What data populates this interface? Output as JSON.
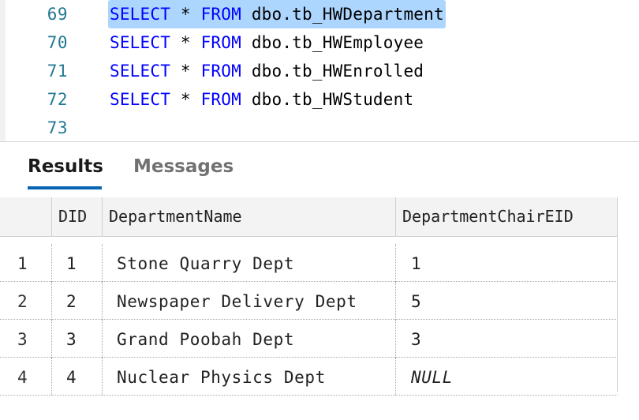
{
  "editor": {
    "lines": [
      {
        "num": "69",
        "kw1": "SELECT",
        "op": "*",
        "kw2": "FROM",
        "table": "dbo.tb_HWDepartment"
      },
      {
        "num": "70",
        "kw1": "SELECT",
        "op": "*",
        "kw2": "FROM",
        "table": "dbo.tb_HWEmployee"
      },
      {
        "num": "71",
        "kw1": "SELECT",
        "op": "*",
        "kw2": "FROM",
        "table": "dbo.tb_HWEnrolled"
      },
      {
        "num": "72",
        "kw1": "SELECT",
        "op": "*",
        "kw2": "FROM",
        "table": "dbo.tb_HWStudent"
      },
      {
        "num": "73"
      }
    ]
  },
  "results_tabs": {
    "results_label": "Results",
    "messages_label": "Messages",
    "active": "Results"
  },
  "grid": {
    "columns": [
      "DID",
      "DepartmentName",
      "DepartmentChairEID"
    ],
    "rows": [
      {
        "rownum": "1",
        "DID": "1",
        "DepartmentName": "Stone Quarry Dept",
        "DepartmentChairEID": "1"
      },
      {
        "rownum": "2",
        "DID": "2",
        "DepartmentName": "Newspaper Delivery Dept",
        "DepartmentChairEID": "5"
      },
      {
        "rownum": "3",
        "DID": "3",
        "DepartmentName": "Grand Poobah Dept",
        "DepartmentChairEID": "3"
      },
      {
        "rownum": "4",
        "DID": "4",
        "DepartmentName": "Nuclear Physics Dept",
        "DepartmentChairEID": "NULL"
      }
    ]
  },
  "colors": {
    "keyword": "#0000ff",
    "line_number": "#237893",
    "selection": "#add6ff",
    "tab_accent": "#0a64b3"
  }
}
